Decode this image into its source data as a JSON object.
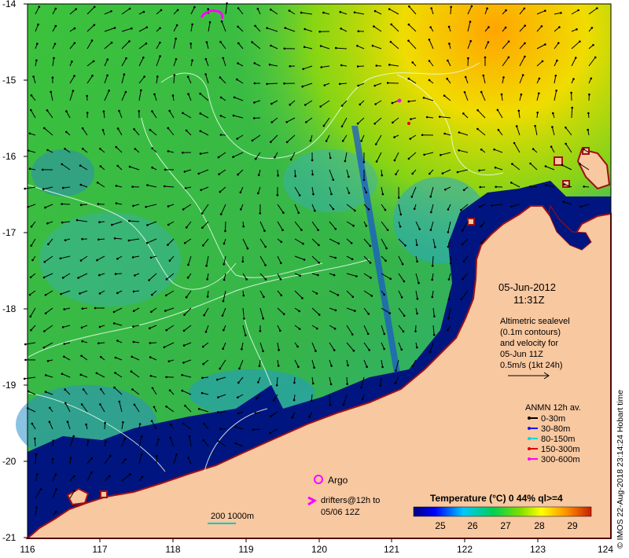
{
  "map": {
    "lat_ticks": [
      "-14",
      "-15",
      "-16",
      "-17",
      "-18",
      "-19",
      "-20",
      "-21"
    ],
    "lon_ticks": [
      "116",
      "117",
      "118",
      "119",
      "120",
      "121",
      "122",
      "123",
      "124"
    ],
    "date": "05-Jun-2012",
    "time": "11:31Z",
    "altimetry_lines": [
      "Altimetric sealevel",
      "(0.1m contours)",
      "and velocity for",
      "05-Jun 11Z",
      "0.5m/s (1kt 24h)"
    ],
    "anmn": {
      "title": "ANMN 12h av.",
      "items": [
        {
          "label": "0-30m",
          "color": "#000000"
        },
        {
          "label": "30-80m",
          "color": "#1414ff"
        },
        {
          "label": "80-150m",
          "color": "#00d8d8"
        },
        {
          "label": "150-300m",
          "color": "#e00000"
        },
        {
          "label": "300-600m",
          "color": "#ff00ff"
        }
      ]
    },
    "argo_label": "Argo",
    "drifters_line1": "drifters@12h to",
    "drifters_line2": "05/06 12Z",
    "scale_label": "200  1000m",
    "colorbar": {
      "title": "Temperature (°C) 0 44% ql>=4",
      "ticks": [
        "25",
        "26",
        "27",
        "28",
        "29"
      ]
    },
    "credit": "© IMOS 22-Aug-2018 23:14:24 Hobart time",
    "colors": {
      "land": "#f8c8a0",
      "coast": "#a01010",
      "cold": "#00157f",
      "warm": "#2fb840"
    }
  }
}
